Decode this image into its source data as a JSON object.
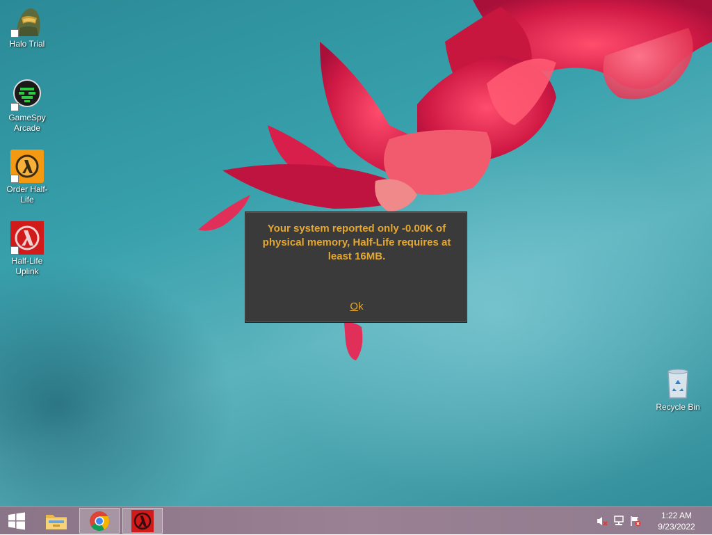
{
  "desktop": {
    "icons": [
      {
        "label": "Halo Trial",
        "icon": "halo-icon"
      },
      {
        "label": "GameSpy Arcade",
        "icon": "gamespy-icon"
      },
      {
        "label": "Order Half-Life",
        "icon": "half-life-order-icon"
      },
      {
        "label": "Half-Life Uplink",
        "icon": "half-life-uplink-icon"
      },
      {
        "label": "Recycle Bin",
        "icon": "recycle-bin-icon"
      }
    ]
  },
  "dialog": {
    "message": "Your system reported only -0.00K of physical memory, Half-Life requires at least 16MB.",
    "ok_mnemonic": "O",
    "ok_rest": "k",
    "text_color": "#e5a72f",
    "background": "#3a3a3a"
  },
  "taskbar": {
    "start_icon": "windows-logo-icon",
    "pinned": [
      {
        "name": "file-explorer",
        "icon": "folder-icon"
      },
      {
        "name": "chrome",
        "icon": "chrome-icon"
      },
      {
        "name": "half-life",
        "icon": "half-life-icon",
        "active": true
      }
    ],
    "tray": {
      "icons": [
        "speaker-muted-icon",
        "network-icon",
        "action-center-flag-icon"
      ],
      "time": "1:22 AM",
      "date": "9/23/2022"
    }
  }
}
